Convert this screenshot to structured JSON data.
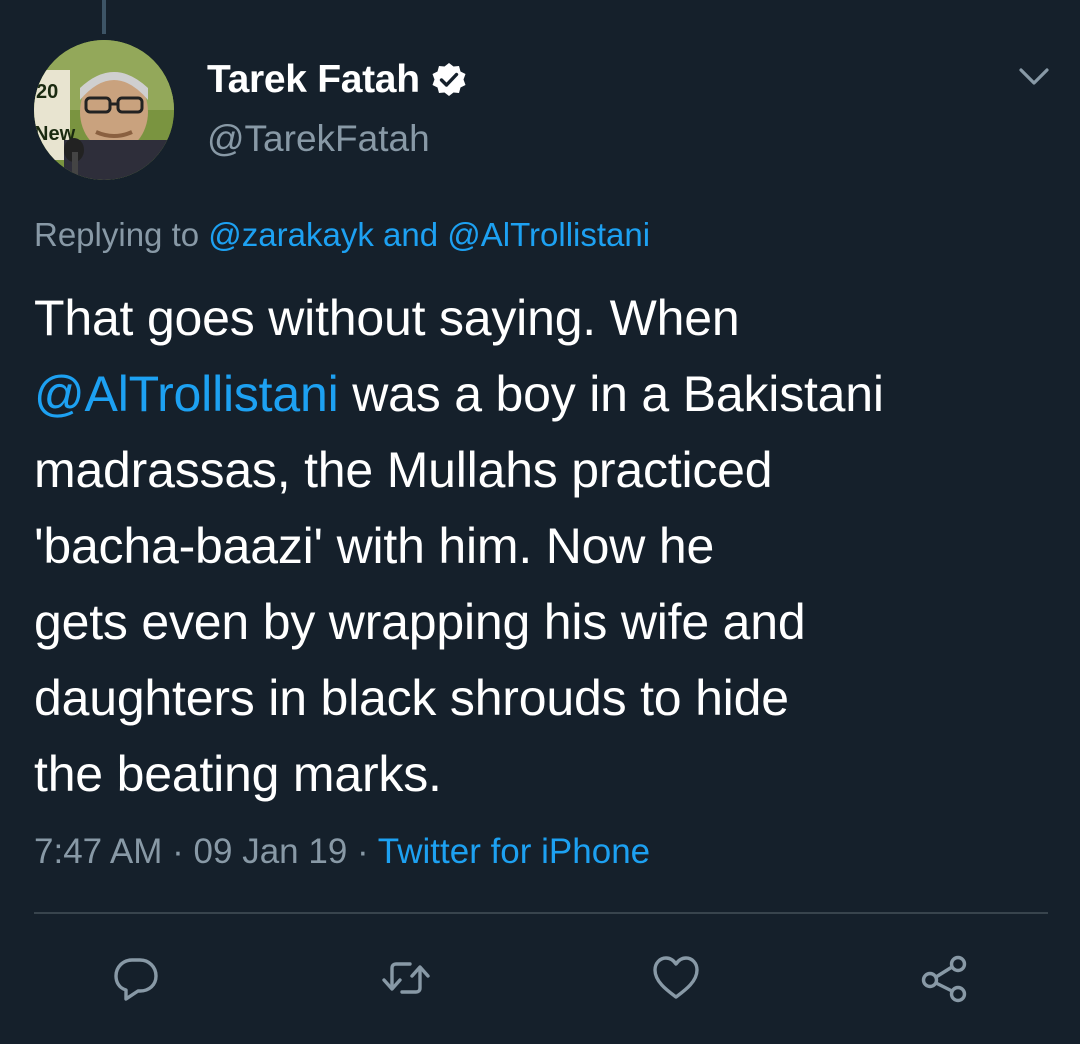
{
  "tweet": {
    "author": {
      "display_name": "Tarek Fatah",
      "handle": "@TarekFatah",
      "verified": true,
      "avatar_badge_text_1": "20",
      "avatar_badge_text_2": "New"
    },
    "replying_to": {
      "prefix": "Replying to",
      "user1": "@zarakayk",
      "conjunction": "and",
      "user2": "@AlTrollistani"
    },
    "text_lines": [
      "That goes without saying. When",
      "was a boy in a Bakistani",
      "madrassas, the Mullahs practiced",
      "'bacha-baazi' with him. Now he",
      "gets even by wrapping his wife and",
      "daughters in black shrouds to hide",
      "the beating marks."
    ],
    "text_mention": "@AlTrollistani",
    "time": "7:47 AM",
    "separator": "·",
    "date": "09 Jan 19",
    "source": "Twitter for iPhone"
  },
  "actions": {
    "reply": "reply-icon",
    "retweet": "retweet-icon",
    "like": "heart-icon",
    "share": "share-icon"
  },
  "colors": {
    "background": "#15202b",
    "link": "#1da1f2",
    "secondary_text": "#8899a6",
    "divider": "#38444d"
  }
}
